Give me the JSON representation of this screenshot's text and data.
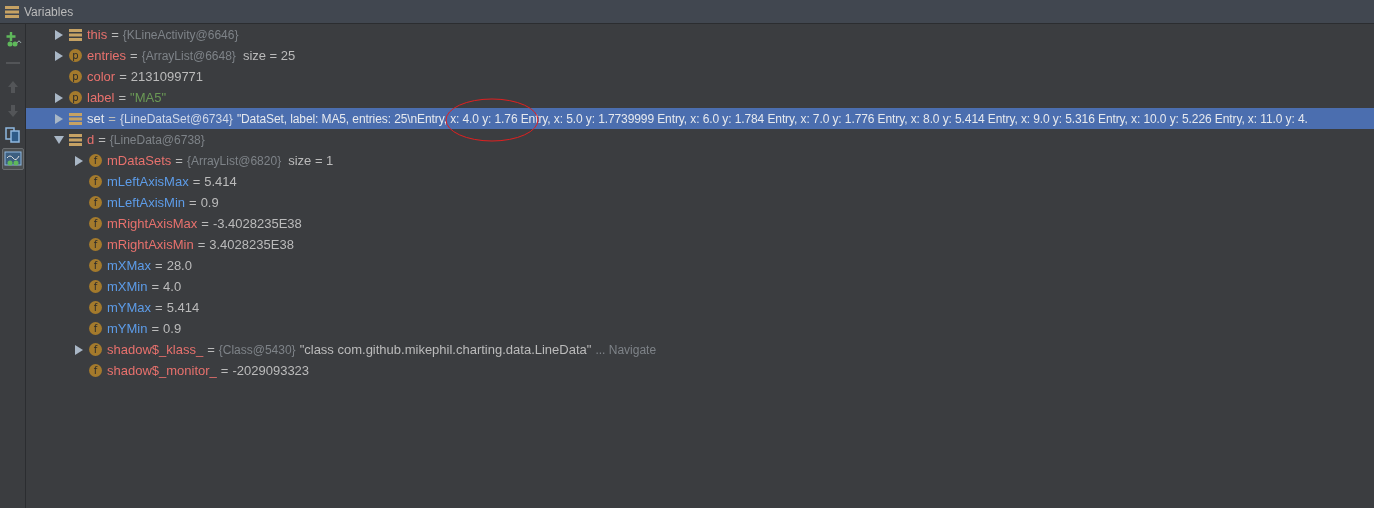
{
  "panel": {
    "title": "Variables"
  },
  "toolbar": [
    {
      "kind": "add-watch",
      "disabled": false,
      "selected": false
    },
    {
      "kind": "remove",
      "disabled": true,
      "selected": false
    },
    {
      "kind": "up",
      "disabled": true,
      "selected": false
    },
    {
      "kind": "down",
      "disabled": true,
      "selected": false
    },
    {
      "kind": "copy",
      "disabled": false,
      "selected": false
    },
    {
      "kind": "watches",
      "disabled": false,
      "selected": true
    }
  ],
  "variables": [
    {
      "kind": "local",
      "name": "this",
      "color": "#e8716d",
      "eq": "=",
      "type": "{KLineActivity@6646}",
      "expanded": false,
      "selected": false
    },
    {
      "kind": "param",
      "badge": "p",
      "name": "entries",
      "color": "#e8716d",
      "eq": "=",
      "type": "{ArrayList@6648}",
      "extra": "size = 25",
      "expanded": false,
      "selected": false
    },
    {
      "kind": "param",
      "badge": "p",
      "name": "color",
      "color": "#e8716d",
      "eq": "=",
      "value": "2131099771",
      "selected": false
    },
    {
      "kind": "param",
      "badge": "p",
      "name": "label",
      "color": "#e8716d",
      "eq": "=",
      "value": {
        "text": "\"MA5\"",
        "color": "#6a9955"
      },
      "expanded": false,
      "selected": false
    },
    {
      "kind": "local",
      "name": "set",
      "eq": "=",
      "type": "{LineDataSet@6734}",
      "value": "\"DataSet, label: MA5, entries: 25\\nEntry, x: 4.0 y: 1.76 Entry, x: 5.0 y: 1.7739999 Entry, x: 6.0 y: 1.784 Entry, x: 7.0 y: 1.776 Entry, x: 8.0 y: 5.414 Entry, x: 9.0 y: 5.316 Entry, x: 10.0 y: 5.226 Entry, x: 11.0 y: 4.",
      "expanded": false,
      "selected": true
    },
    {
      "kind": "local",
      "name": "d",
      "color": "#e8716d",
      "eq": "=",
      "type": "{LineData@6738}",
      "expanded": true,
      "selected": false,
      "children": [
        {
          "kind": "field",
          "badge": "f",
          "name": "mDataSets",
          "color": "#e8716d",
          "eq": "=",
          "type": "{ArrayList@6820}",
          "extra": "size = 1",
          "expanded": false,
          "selected": false
        },
        {
          "kind": "field",
          "badge": "f",
          "name": "mLeftAxisMax",
          "color": "#5d9ce8",
          "eq": "=",
          "value": "5.414",
          "selected": false
        },
        {
          "kind": "field",
          "badge": "f",
          "name": "mLeftAxisMin",
          "color": "#5d9ce8",
          "eq": "=",
          "value": "0.9",
          "selected": false
        },
        {
          "kind": "field",
          "badge": "f",
          "name": "mRightAxisMax",
          "color": "#e8716d",
          "eq": "=",
          "value": "-3.4028235E38",
          "selected": false
        },
        {
          "kind": "field",
          "badge": "f",
          "name": "mRightAxisMin",
          "color": "#e8716d",
          "eq": "=",
          "value": "3.4028235E38",
          "selected": false
        },
        {
          "kind": "field",
          "badge": "f",
          "name": "mXMax",
          "color": "#5d9ce8",
          "eq": "=",
          "value": "28.0",
          "selected": false
        },
        {
          "kind": "field",
          "badge": "f",
          "name": "mXMin",
          "color": "#5d9ce8",
          "eq": "=",
          "value": "4.0",
          "selected": false
        },
        {
          "kind": "field",
          "badge": "f",
          "name": "mYMax",
          "color": "#5d9ce8",
          "eq": "=",
          "value": "5.414",
          "selected": false
        },
        {
          "kind": "field",
          "badge": "f",
          "name": "mYMin",
          "color": "#5d9ce8",
          "eq": "=",
          "value": "0.9",
          "selected": false
        },
        {
          "kind": "field",
          "badge": "f",
          "name": "shadow$_klass_",
          "color": "#e8716d",
          "eq": "=",
          "type": "{Class@5430}",
          "value": "\"class com.github.mikephil.charting.data.LineData\"",
          "link": "... Navigate",
          "expanded": false,
          "selected": false
        },
        {
          "kind": "field",
          "badge": "f",
          "name": "shadow$_monitor_",
          "color": "#e8716d",
          "eq": "=",
          "value": "-2029093323",
          "selected": false
        }
      ]
    }
  ]
}
